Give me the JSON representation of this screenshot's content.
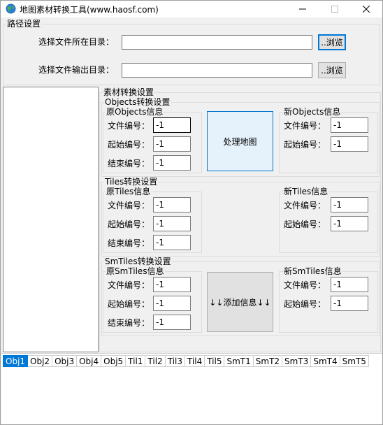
{
  "window": {
    "title": "地图素材转换工具(www.haosf.com)"
  },
  "path_settings": {
    "group_label": "路径设置",
    "input_dir_label": "选择文件所在目录：",
    "input_dir_value": "",
    "output_dir_label": "选择文件输出目录：",
    "output_dir_value": "",
    "browse_label": "..浏览"
  },
  "convert_settings": {
    "group_label": "素材转换设置",
    "objects": {
      "group_label": "Objects转换设置",
      "original_label": "原Objects信息",
      "new_label": "新Objects信息",
      "action_label": "处理地图"
    },
    "tiles": {
      "group_label": "Tiles转换设置",
      "original_label": "原Tiles信息",
      "new_label": "新Tiles信息"
    },
    "smtiles": {
      "group_label": "SmTiles转换设置",
      "original_label": "原SmTiles信息",
      "new_label": "新SmTiles信息",
      "action_label": "↓↓添加信息↓↓"
    },
    "file_no_label": "文件编号：",
    "start_no_label": "起始编号：",
    "end_no_label": "结束编号：",
    "default_value": "-1"
  },
  "tabs": [
    "Obj1",
    "Obj2",
    "Obj3",
    "Obj4",
    "Obj5",
    "Til1",
    "Til2",
    "Til3",
    "Til4",
    "Til5",
    "SmT1",
    "SmT2",
    "SmT3",
    "SmT4",
    "SmT5"
  ],
  "colors": {
    "accent": "#0078d7",
    "window_bg": "#f0f0f0"
  }
}
